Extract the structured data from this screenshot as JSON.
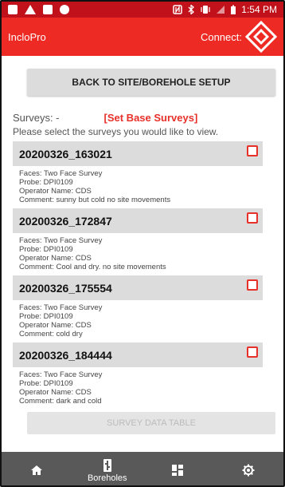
{
  "status_bar": {
    "time": "1:54 PM",
    "bar_color": "#c1121b"
  },
  "app_bar": {
    "title": "IncloPro",
    "connect_label": "Connect:",
    "connect_icon": "diamond-arrows-icon",
    "bar_color": "#ee2a24"
  },
  "back_button": {
    "label": "BACK TO SITE/BOREHOLE SETUP"
  },
  "surveys_header": {
    "label": "Surveys: -",
    "set_base_link": "[Set Base Surveys]",
    "instructions": "Please select the surveys you would like to view."
  },
  "surveys": [
    {
      "name": "20200326_163021",
      "faces": "Faces: Two Face Survey",
      "probe": "Probe: DPI0109",
      "operator": "Operator Name: CDS",
      "comment": "Comment: sunny but cold no site movements",
      "checked": false
    },
    {
      "name": "20200326_172847",
      "faces": "Faces: Two Face Survey",
      "probe": "Probe: DPI0109",
      "operator": "Operator Name: CDS",
      "comment": "Comment: Cool and dry. no site movements",
      "checked": false
    },
    {
      "name": "20200326_175554",
      "faces": "Faces: Two Face Survey",
      "probe": "Probe: DPI0109",
      "operator": "Operator Name: CDS",
      "comment": "Comment: cold dry",
      "checked": false
    },
    {
      "name": "20200326_184444",
      "faces": "Faces: Two Face Survey",
      "probe": "Probe: DPI0109",
      "operator": "Operator Name: CDS",
      "comment": "Comment: dark and cold",
      "checked": false
    }
  ],
  "survey_table_button": {
    "label": "SURVEY DATA TABLE"
  },
  "bottom_nav": {
    "items": [
      {
        "icon": "home-icon",
        "label": ""
      },
      {
        "icon": "boreholes-icon",
        "label": "Boreholes"
      },
      {
        "icon": "dashboard-icon",
        "label": ""
      },
      {
        "icon": "settings-icon",
        "label": ""
      }
    ],
    "bar_color": "#595959"
  },
  "accent_color": "#e8302a"
}
